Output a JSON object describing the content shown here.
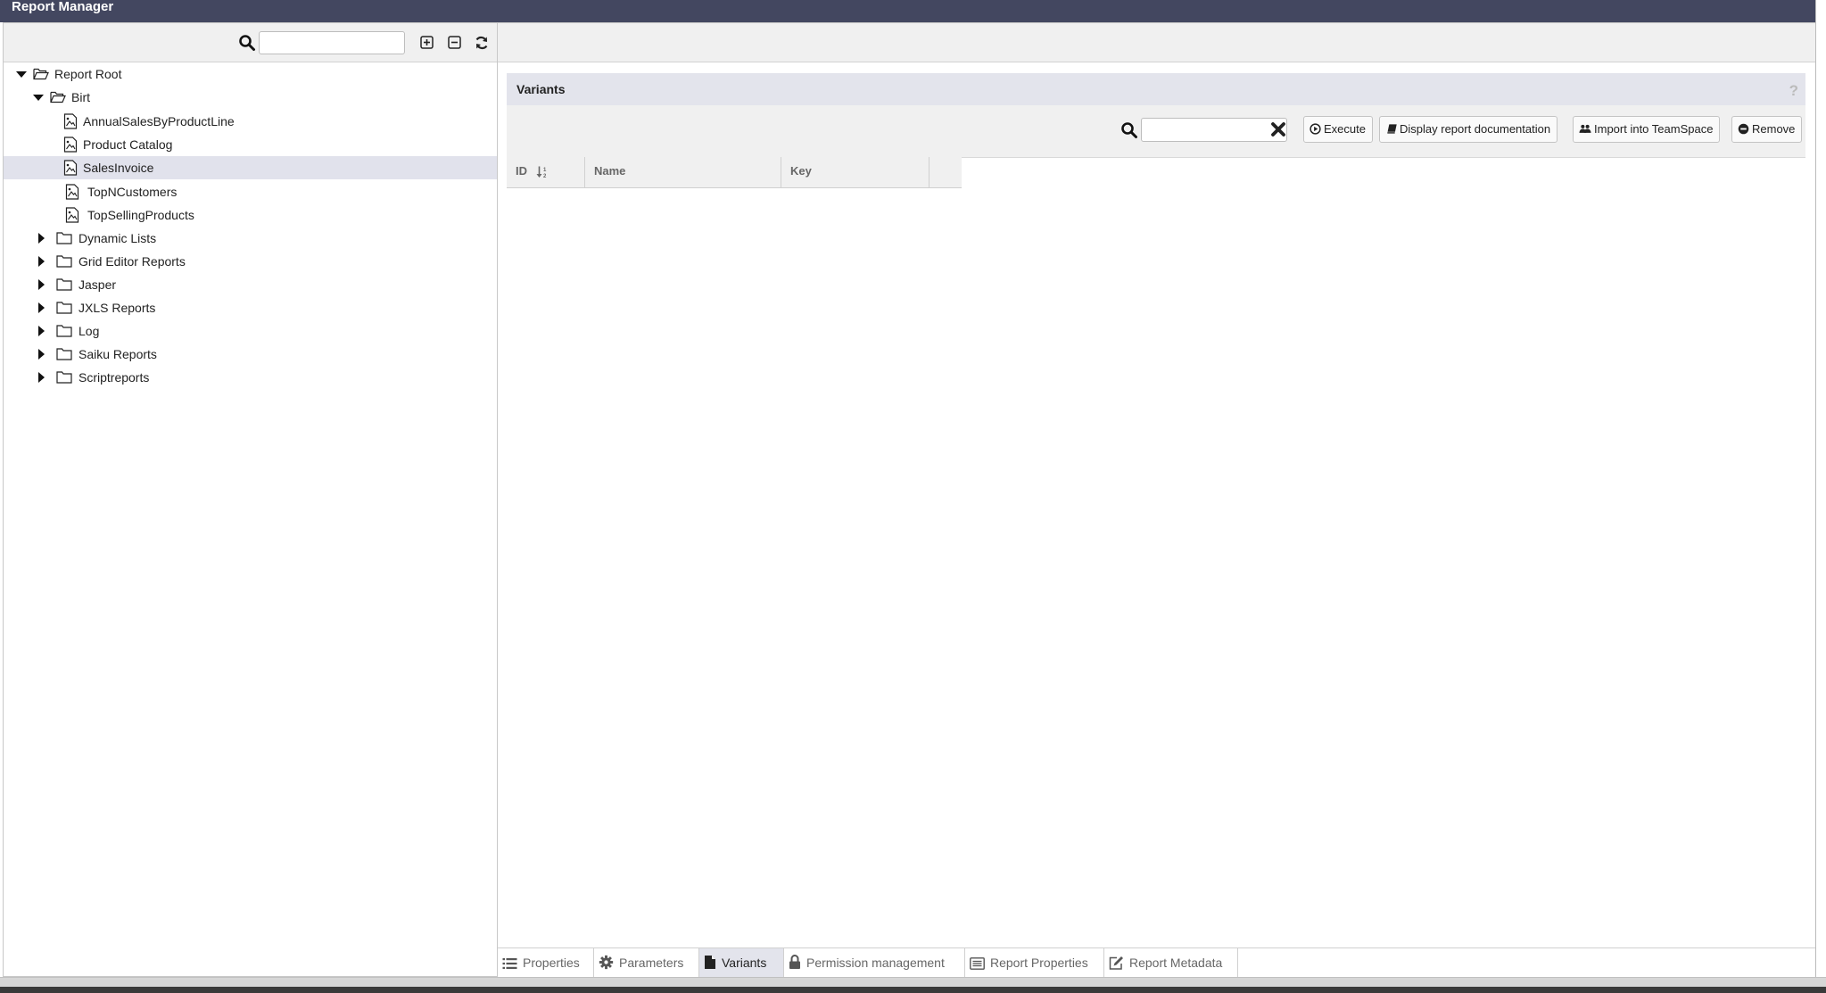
{
  "window": {
    "title": "Report Manager"
  },
  "tree_toolbar": {
    "search_placeholder": ""
  },
  "tree": {
    "root": "Report Root",
    "birt": "Birt",
    "birt_items": [
      "AnnualSalesByProductLine",
      "Product Catalog",
      "SalesInvoice",
      "TopNCustomers",
      "TopSellingProducts"
    ],
    "selected": "SalesInvoice",
    "folders": [
      "Dynamic Lists",
      "Grid Editor Reports",
      "Jasper",
      "JXLS Reports",
      "Log",
      "Saiku Reports",
      "Scriptreports"
    ]
  },
  "variants": {
    "title": "Variants",
    "help": "?",
    "search_placeholder": "",
    "buttons": {
      "execute": "Execute",
      "display_doc": "Display report documentation",
      "import": "Import into TeamSpace",
      "remove": "Remove"
    },
    "columns": [
      "ID",
      "Name",
      "Key"
    ]
  },
  "tabs": [
    "Properties",
    "Parameters",
    "Variants",
    "Permission management",
    "Report Properties",
    "Report Metadata"
  ],
  "active_tab": "Variants",
  "colors": {
    "titlebar": "#434760",
    "header_bg": "#e3e4ec",
    "selection": "#e1e2ec",
    "toolbar_bg": "#f0f0f0"
  }
}
